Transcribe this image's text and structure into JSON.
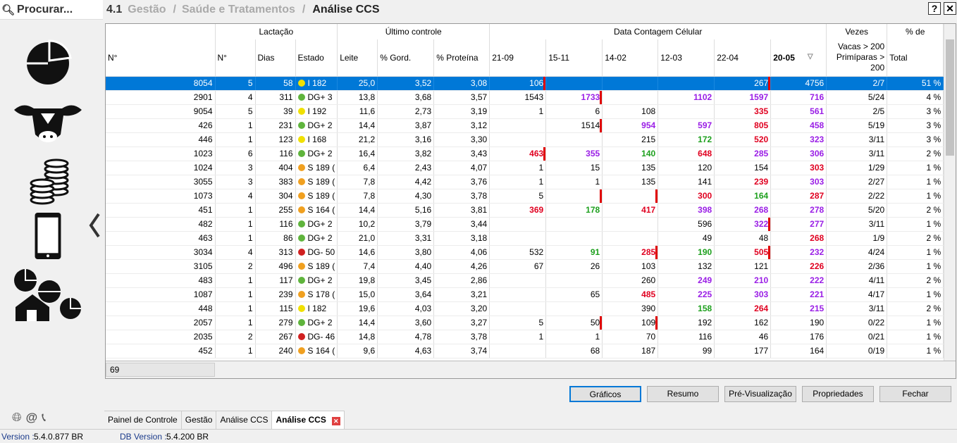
{
  "search": {
    "label": "Procurar..."
  },
  "header": {
    "num": "4.1",
    "crumb1": "Gestão",
    "crumb2": "Saúde e Tratamentos",
    "sep": "/",
    "current": "Análise CCS",
    "help": "?",
    "close": "✕"
  },
  "columns": {
    "groups": [
      "Lactação",
      "Último controle",
      "Data Contagem Célular",
      "Vezes",
      "% de"
    ],
    "headers": [
      "N°",
      "N°",
      "Dias",
      "Estado",
      "Leite",
      "% Gord.",
      "% Proteína",
      "21-09",
      "15-11",
      "14-02",
      "12-03",
      "22-04",
      "20-05",
      "Vacas > 200 Primíparas > 200",
      "Total"
    ],
    "sort_icon": "▽"
  },
  "rows": [
    {
      "n": "8054",
      "lac": "5",
      "dias": "58",
      "estado": {
        "color": "yellow",
        "text": "I 182"
      },
      "leite": "25,0",
      "gord": "3,52",
      "prot": "3,08",
      "c": [
        "106",
        "",
        "",
        "",
        "267",
        "4756"
      ],
      "vezes": "2/7",
      "total": "51 %"
    },
    {
      "n": "2901",
      "lac": "4",
      "dias": "311",
      "estado": {
        "color": "green",
        "text": "DG+ 3"
      },
      "leite": "13,8",
      "gord": "3,68",
      "prot": "3,57",
      "c": [
        "1543",
        "1733",
        "",
        "1102",
        "1597",
        "716"
      ],
      "vezes": "5/24",
      "total": "4 %"
    },
    {
      "n": "9054",
      "lac": "5",
      "dias": "39",
      "estado": {
        "color": "yellow",
        "text": "I 192"
      },
      "leite": "11,6",
      "gord": "2,73",
      "prot": "3,19",
      "c": [
        "1",
        "6",
        "108",
        "",
        "335",
        "561"
      ],
      "vezes": "2/5",
      "total": "3 %"
    },
    {
      "n": "426",
      "lac": "1",
      "dias": "231",
      "estado": {
        "color": "green",
        "text": "DG+ 2"
      },
      "leite": "14,4",
      "gord": "3,87",
      "prot": "3,12",
      "c": [
        "",
        "1514",
        "954",
        "597",
        "805",
        "458"
      ],
      "vezes": "5/19",
      "total": "3 %"
    },
    {
      "n": "446",
      "lac": "1",
      "dias": "123",
      "estado": {
        "color": "yellow",
        "text": "I 168"
      },
      "leite": "21,2",
      "gord": "3,16",
      "prot": "3,30",
      "c": [
        "",
        "",
        "215",
        "172",
        "520",
        "323"
      ],
      "vezes": "3/11",
      "total": "3 %"
    },
    {
      "n": "1023",
      "lac": "6",
      "dias": "116",
      "estado": {
        "color": "green",
        "text": "DG+ 2"
      },
      "leite": "16,4",
      "gord": "3,82",
      "prot": "3,43",
      "c": [
        "463",
        "355",
        "140",
        "648",
        "285",
        "306"
      ],
      "vezes": "3/11",
      "total": "2 %"
    },
    {
      "n": "1024",
      "lac": "3",
      "dias": "404",
      "estado": {
        "color": "orange",
        "text": "S 189 ("
      },
      "leite": "6,4",
      "gord": "2,43",
      "prot": "4,07",
      "c": [
        "1",
        "15",
        "135",
        "120",
        "154",
        "303"
      ],
      "vezes": "1/29",
      "total": "1 %"
    },
    {
      "n": "3055",
      "lac": "3",
      "dias": "383",
      "estado": {
        "color": "orange",
        "text": "S 189 ("
      },
      "leite": "7,8",
      "gord": "4,42",
      "prot": "3,76",
      "c": [
        "1",
        "1",
        "135",
        "141",
        "239",
        "303"
      ],
      "vezes": "2/27",
      "total": "1 %"
    },
    {
      "n": "1073",
      "lac": "4",
      "dias": "304",
      "estado": {
        "color": "orange",
        "text": "S 189 ("
      },
      "leite": "7,8",
      "gord": "4,30",
      "prot": "3,78",
      "c": [
        "5",
        "",
        "",
        "300",
        "164",
        "287"
      ],
      "vezes": "2/22",
      "total": "1 %"
    },
    {
      "n": "451",
      "lac": "1",
      "dias": "255",
      "estado": {
        "color": "orange",
        "text": "S 164 ("
      },
      "leite": "14,4",
      "gord": "5,16",
      "prot": "3,81",
      "c": [
        "369",
        "178",
        "417",
        "398",
        "268",
        "278"
      ],
      "vezes": "5/20",
      "total": "2 %"
    },
    {
      "n": "482",
      "lac": "1",
      "dias": "116",
      "estado": {
        "color": "green",
        "text": "DG+ 2"
      },
      "leite": "10,2",
      "gord": "3,79",
      "prot": "3,44",
      "c": [
        "",
        "",
        "",
        "596",
        "322",
        "277"
      ],
      "vezes": "3/11",
      "total": "1 %"
    },
    {
      "n": "463",
      "lac": "1",
      "dias": "86",
      "estado": {
        "color": "green",
        "text": "DG+ 2"
      },
      "leite": "21,0",
      "gord": "3,31",
      "prot": "3,18",
      "c": [
        "",
        "",
        "",
        "49",
        "48",
        "268"
      ],
      "vezes": "1/9",
      "total": "2 %"
    },
    {
      "n": "3034",
      "lac": "4",
      "dias": "313",
      "estado": {
        "color": "red",
        "text": "DG- 50"
      },
      "leite": "14,6",
      "gord": "3,80",
      "prot": "4,06",
      "c": [
        "532",
        "91",
        "285",
        "190",
        "505",
        "232"
      ],
      "vezes": "4/24",
      "total": "1 %"
    },
    {
      "n": "3105",
      "lac": "2",
      "dias": "496",
      "estado": {
        "color": "orange",
        "text": "S 189 ("
      },
      "leite": "7,4",
      "gord": "4,40",
      "prot": "4,26",
      "c": [
        "67",
        "26",
        "103",
        "132",
        "121",
        "226"
      ],
      "vezes": "2/36",
      "total": "1 %"
    },
    {
      "n": "483",
      "lac": "1",
      "dias": "117",
      "estado": {
        "color": "green",
        "text": "DG+ 2"
      },
      "leite": "19,8",
      "gord": "3,45",
      "prot": "2,86",
      "c": [
        "",
        "",
        "260",
        "249",
        "210",
        "222"
      ],
      "vezes": "4/11",
      "total": "2 %"
    },
    {
      "n": "1087",
      "lac": "1",
      "dias": "239",
      "estado": {
        "color": "orange",
        "text": "S 178 ("
      },
      "leite": "15,0",
      "gord": "3,64",
      "prot": "3,21",
      "c": [
        "",
        "65",
        "485",
        "225",
        "303",
        "221"
      ],
      "vezes": "4/17",
      "total": "1 %"
    },
    {
      "n": "448",
      "lac": "1",
      "dias": "115",
      "estado": {
        "color": "yellow",
        "text": "I 182"
      },
      "leite": "19,6",
      "gord": "4,03",
      "prot": "3,20",
      "c": [
        "",
        "",
        "390",
        "158",
        "264",
        "215"
      ],
      "vezes": "3/11",
      "total": "2 %"
    },
    {
      "n": "2057",
      "lac": "1",
      "dias": "279",
      "estado": {
        "color": "green",
        "text": "DG+ 2"
      },
      "leite": "14,4",
      "gord": "3,60",
      "prot": "3,27",
      "c": [
        "5",
        "50",
        "109",
        "192",
        "162",
        "190"
      ],
      "vezes": "0/22",
      "total": "1 %"
    },
    {
      "n": "2035",
      "lac": "2",
      "dias": "267",
      "estado": {
        "color": "red",
        "text": "DG- 46"
      },
      "leite": "14,8",
      "gord": "4,78",
      "prot": "3,78",
      "c": [
        "1",
        "1",
        "70",
        "116",
        "46",
        "176"
      ],
      "vezes": "0/21",
      "total": "1 %"
    },
    {
      "n": "452",
      "lac": "1",
      "dias": "240",
      "estado": {
        "color": "orange",
        "text": "S 164 ("
      },
      "leite": "9,6",
      "gord": "4,63",
      "prot": "3,74",
      "c": [
        "",
        "68",
        "187",
        "99",
        "177",
        "164"
      ],
      "vezes": "0/19",
      "total": "1 %"
    }
  ],
  "footer": {
    "count": "69"
  },
  "buttons": {
    "graficos": "Gráficos",
    "resumo": "Resumo",
    "previsualizacao": "Pré-Visualização",
    "propriedades": "Propriedades",
    "fechar": "Fechar"
  },
  "tabs": [
    "Painel de Controle",
    "Gestão",
    "Análise CCS",
    "Análise CCS"
  ],
  "status": {
    "version_label": "Version :",
    "version": "5.4.0.877 BR",
    "db_label": "DB Version :",
    "db": "5.4.200 BR"
  },
  "colors": {
    "selection": "#0078d7",
    "purple": "#9a1ee6",
    "red": "#e00020",
    "green": "#1ea01e",
    "dot_yellow": "#f0e000",
    "dot_green": "#5fb43c",
    "dot_orange": "#f0a020",
    "dot_red": "#d02020"
  },
  "icons": [
    "search-icon",
    "pie-chart-icon",
    "cow-icon",
    "coins-icon",
    "mobile-phone-icon",
    "farm-charts-icon",
    "collapse-chevron-icon",
    "globe-icon",
    "at-icon",
    "phone-icon",
    "tab-close-icon"
  ]
}
